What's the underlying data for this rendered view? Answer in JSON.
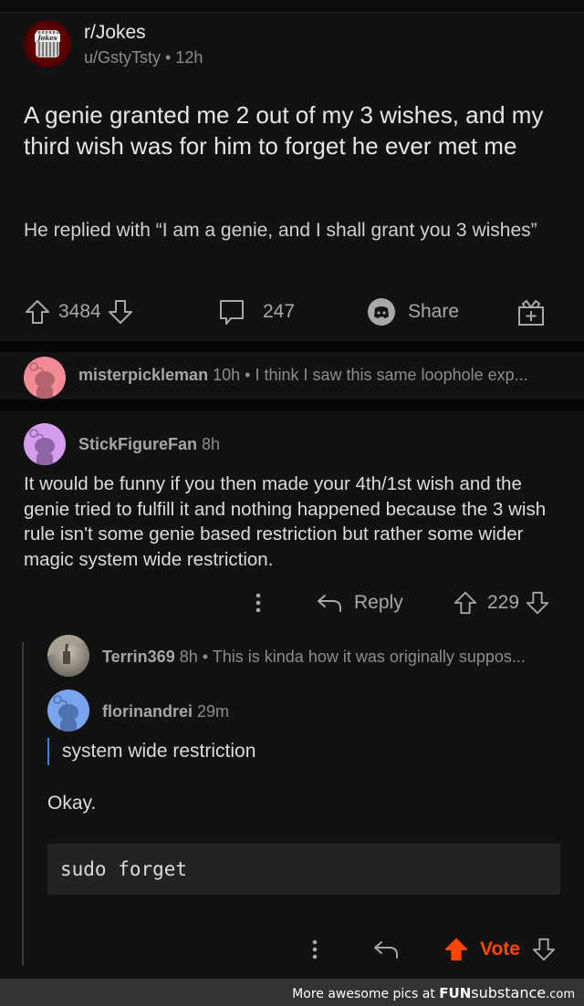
{
  "post": {
    "subreddit": "r/Jokes",
    "subreddit_icon_label": "Jokes",
    "author": "u/GstyTsty",
    "age": "12h",
    "separator": "•",
    "title": "A genie granted me 2 out of my 3 wishes, and my third wish was for him to forget he ever met me",
    "body": "He replied with “I am a genie, and I shall grant you 3 wishes”",
    "score": "3484",
    "comment_count": "247",
    "share_label": "Share"
  },
  "comments": [
    {
      "collapsed": true,
      "author": "misterpickleman",
      "age": "10h",
      "preview": "I think I saw this same loophole exp...",
      "avatar_color": "#f28b96"
    },
    {
      "author": "StickFigureFan",
      "age": "8h",
      "avatar_color": "#d59cf0",
      "body": "It would be funny if you then made your 4th/1st wish and the genie tried to fulfill it and nothing happened because the 3 wish rule isn't some genie based restriction but rather some wider magic system wide restriction.",
      "reply_label": "Reply",
      "score": "229",
      "replies": [
        {
          "collapsed": true,
          "author": "Terrin369",
          "age": "8h",
          "preview": "This is kinda how it was originally suppos..."
        },
        {
          "author": "florinandrei",
          "age": "29m",
          "avatar_color": "#7aa3f0",
          "quote": "system wide restriction",
          "text": "Okay.",
          "code": "sudo forget",
          "vote_label": "Vote"
        }
      ]
    }
  ],
  "footer": {
    "prefix": "More awesome pics at ",
    "brand_fun": "FUN",
    "brand_sub": "substance",
    "brand_tld": ".com"
  },
  "colors": {
    "background": "#121212",
    "accent_orange": "#ff4500",
    "quote_bar": "#3e83d6",
    "muted_text": "#8a8c8e"
  }
}
